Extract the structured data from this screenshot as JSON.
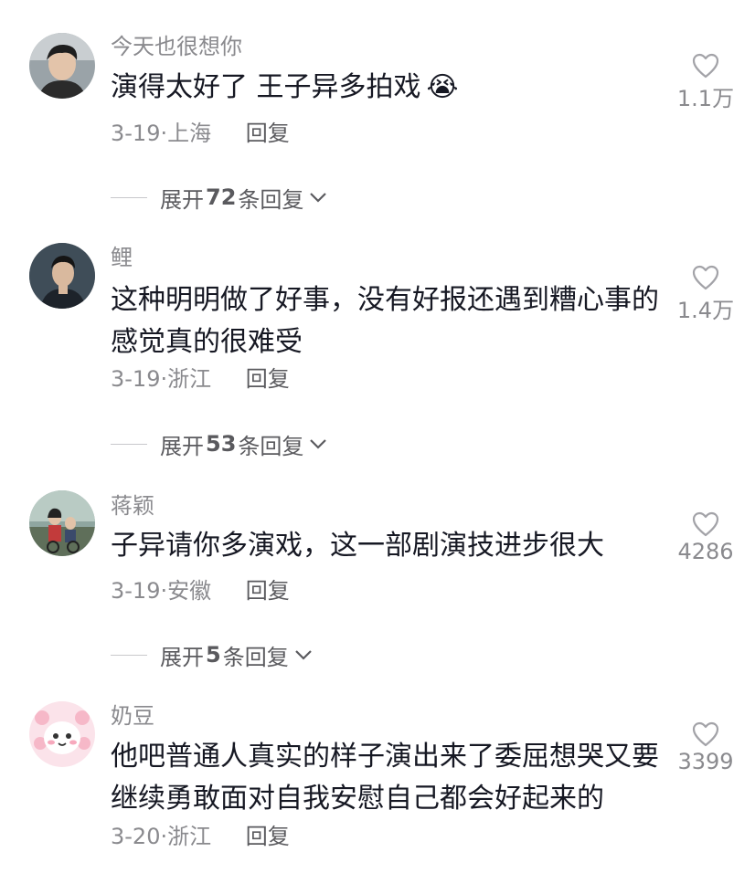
{
  "comments": [
    {
      "username": "今天也很想你",
      "lines": [
        "演得太好了 王子异多拍戏"
      ],
      "emoji": "😭",
      "date": "3-19",
      "location": "上海",
      "reply_label": "回复",
      "likes": "1.1万",
      "expand": {
        "prefix": "展开",
        "count": "72",
        "suffix": "条回复"
      }
    },
    {
      "username": "鲤",
      "lines": [
        "这种明明做了好事，没有好报还遇到糟心事的",
        "感觉真的很难受"
      ],
      "date": "3-19",
      "location": "浙江",
      "reply_label": "回复",
      "likes": "1.4万",
      "expand": {
        "prefix": "展开",
        "count": "53",
        "suffix": "条回复"
      }
    },
    {
      "username": "蒋颖",
      "lines": [
        "子异请你多演戏，这一部剧演技进步很大"
      ],
      "date": "3-19",
      "location": "安徽",
      "reply_label": "回复",
      "likes": "4286",
      "expand": {
        "prefix": "展开",
        "count": "5",
        "suffix": "条回复"
      }
    },
    {
      "username": "奶豆",
      "lines": [
        "他吧普通人真实的样子演出来了委屈想哭又要",
        "继续勇敢面对自我安慰自己都会好起来的"
      ],
      "date": "3-20",
      "location": "浙江",
      "reply_label": "回复",
      "likes": "3399"
    }
  ],
  "icons": {
    "like": "heart-outline-icon",
    "expand": "chevron-down-icon"
  },
  "colors": {
    "text": "#161823",
    "secondary": "#8a8a8e",
    "reply": "#5a5a5e"
  }
}
